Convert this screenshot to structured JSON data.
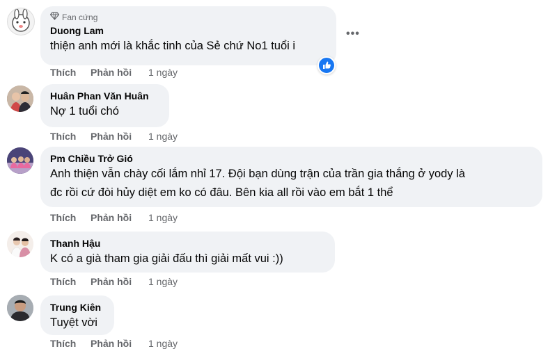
{
  "comments": [
    {
      "badge": "Fan cứng",
      "name": "Duong Lam",
      "text": "thiện anh mới là khắc tinh của Sẻ chứ No1 tuổi i",
      "like": "Thích",
      "reply": "Phản hồi",
      "time": "1 ngày",
      "more": "•••"
    },
    {
      "name": "Huân Phan Văn Huân",
      "text": "Nợ 1 tuổi chó",
      "like": "Thích",
      "reply": "Phản hồi",
      "time": "1 ngày"
    },
    {
      "name": "Pm Chiều Trở Gió",
      "text_line1": "Anh thiện vẫn chày cối lắm nhỉ 17. Đội bạn dùng trận của trần gia thắng ở yody là",
      "text_line2": "đc rồi cứ đòi hủy diệt em ko có đâu. Bên kia all rồi vào em bắt 1 thể",
      "like": "Thích",
      "reply": "Phản hồi",
      "time": "1 ngày"
    },
    {
      "name": "Thanh Hậu",
      "text": "K có a già tham gia giải đấu thì giải mất vui :))",
      "like": "Thích",
      "reply": "Phản hồi",
      "time": "1 ngày"
    },
    {
      "name": "Trung Kiên",
      "text": "Tuyệt vời",
      "like": "Thích",
      "reply": "Phản hồi",
      "time": "1 ngày"
    }
  ],
  "colors": {
    "bubble": "#f0f2f5",
    "meta": "#65676b",
    "like_badge": "#1877f2"
  },
  "icons": {
    "badge": "diamond-icon",
    "reaction": "like-thumb-icon",
    "more": "more-options-icon"
  }
}
